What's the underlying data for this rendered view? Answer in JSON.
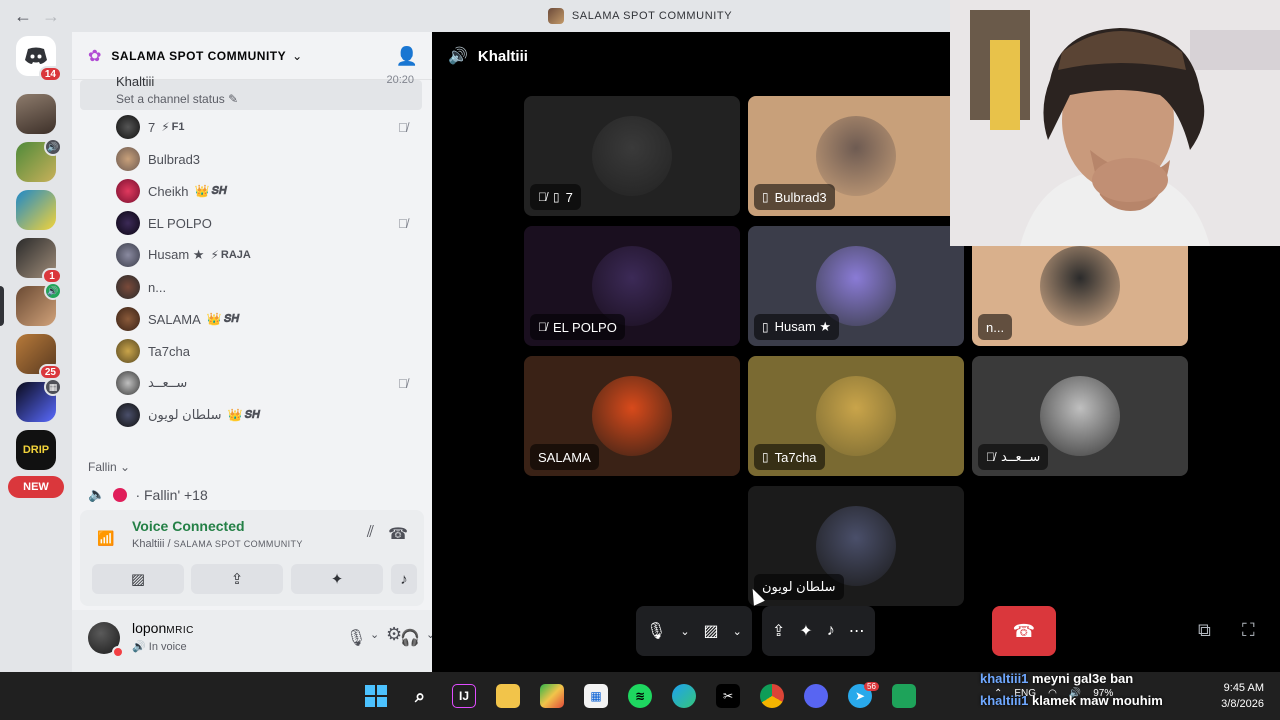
{
  "titlebar": {
    "title": "SALAMA SPOT COMMUNITY",
    "back_icon": "arrow-left-icon",
    "forward_icon": "arrow-right-icon"
  },
  "rail": {
    "home_badge": "14",
    "servers": [
      {
        "badge": ""
      },
      {
        "badge": ""
      },
      {
        "badge": ""
      },
      {
        "badge": "1"
      },
      {
        "badge": ""
      },
      {
        "badge": "25"
      },
      {
        "badge": ""
      },
      {
        "badge": ""
      }
    ],
    "new_label": "NEW"
  },
  "sidebar": {
    "guild_name": "SALAMA SPOT COMMUNITY",
    "self_name": "Khaltiii",
    "self_time": "20:20",
    "set_status": "Set a channel status",
    "members": [
      {
        "name": "7",
        "tag": "F1",
        "tag_icon": "⚡"
      },
      {
        "name": "Bulbrad3",
        "tag": "",
        "tag_icon": ""
      },
      {
        "name": "Cheikh",
        "tag": "𝑺𝑯",
        "tag_icon": "👑"
      },
      {
        "name": "EL POLPO",
        "tag": "",
        "tag_icon": ""
      },
      {
        "name": "Husam ★",
        "tag": "RAJA",
        "tag_icon": "⚡"
      },
      {
        "name": "n...",
        "tag": "",
        "tag_icon": ""
      },
      {
        "name": "SALAMA",
        "tag": "𝑺𝑯",
        "tag_icon": "👑"
      },
      {
        "name": "Ta7cha",
        "tag": "",
        "tag_icon": ""
      },
      {
        "name": "ســعــد",
        "tag": "",
        "tag_icon": ""
      },
      {
        "name": "سلطان لويون",
        "tag": "𝑺𝑯",
        "tag_icon": "👑"
      }
    ],
    "category": "Fallin",
    "voice_channel": "· Fallin' +18"
  },
  "voice_panel": {
    "title": "Voice Connected",
    "user": "Khaltiii",
    "server": "SALAMA SPOT COMMUNITY"
  },
  "user_area": {
    "name": "lopon",
    "name_suffix": "MRIC",
    "status": "In voice"
  },
  "stage": {
    "channel": "Khaltiii",
    "tiles": [
      {
        "label": "7",
        "colors": [
          "#222",
          "#3a3a3a"
        ]
      },
      {
        "label": "Bulbrad3",
        "colors": [
          "#c8a07a",
          "#6e5b52"
        ]
      },
      {
        "label": "EL POLPO",
        "colors": [
          "#1a0f1f",
          "#3c2a57"
        ]
      },
      {
        "label": "Husam ★",
        "colors": [
          "#3b3d4a",
          "#8a7bd6"
        ]
      },
      {
        "label": "n...",
        "colors": [
          "#d9b08c",
          "#2b2b2b"
        ]
      },
      {
        "label": "SALAMA",
        "colors": [
          "#3a2216",
          "#d84a1b"
        ]
      },
      {
        "label": "Ta7cha",
        "colors": [
          "#7a6a32",
          "#c9a44a"
        ]
      },
      {
        "label": "ســعــد",
        "colors": [
          "#3a3a3a",
          "#bfbfbf"
        ]
      },
      {
        "label": "سلطان لويون",
        "colors": [
          "#1b1b1b",
          "#4a4f6a"
        ]
      }
    ]
  },
  "taskbar": {
    "time": "9:45 AM",
    "date": "3/8/2026",
    "lang": "ENG",
    "battery": "97%",
    "telegram_badge": "56"
  },
  "overlay_chat": [
    {
      "user": "khaltiii1",
      "text": "meyni gal3e ban"
    },
    {
      "user": "khaltiii1",
      "text": "klamek maw mouhim"
    }
  ]
}
